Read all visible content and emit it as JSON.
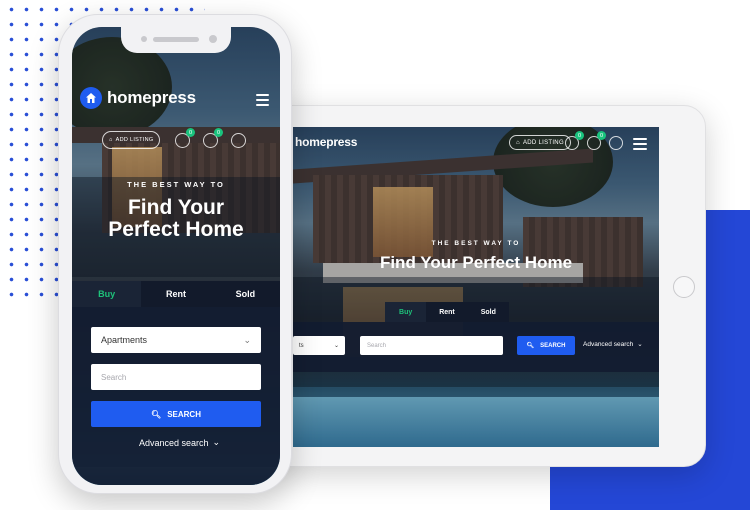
{
  "brand": {
    "name": "homepress"
  },
  "colors": {
    "accent": "#1f5cf0",
    "green": "#1ec27a",
    "navy": "#121a2b",
    "decor_blue": "#2447d6"
  },
  "header": {
    "add_listing_label": "ADD LISTING",
    "compare_count": "0",
    "favorites_count": "0"
  },
  "hero": {
    "kicker": "THE BEST WAY TO",
    "headline_phone_line1": "Find Your",
    "headline_phone_line2": "Perfect Home",
    "headline_tablet": "Find Your Perfect Home"
  },
  "tabs": [
    {
      "label": "Buy",
      "active": true
    },
    {
      "label": "Rent",
      "active": false
    },
    {
      "label": "Sold",
      "active": false
    }
  ],
  "search": {
    "type_value": "Apartments",
    "type_value_tablet_partial": "ts",
    "placeholder": "Search",
    "button_label": "SEARCH",
    "advanced_label": "Advanced search"
  },
  "icons": {
    "logo": "house-icon",
    "menu": "hamburger-icon",
    "add": "home-plus-icon",
    "compare": "compare-icon",
    "favorite": "heart-icon",
    "account": "user-icon",
    "search": "search-icon",
    "chevron": "chevron-down-icon"
  }
}
